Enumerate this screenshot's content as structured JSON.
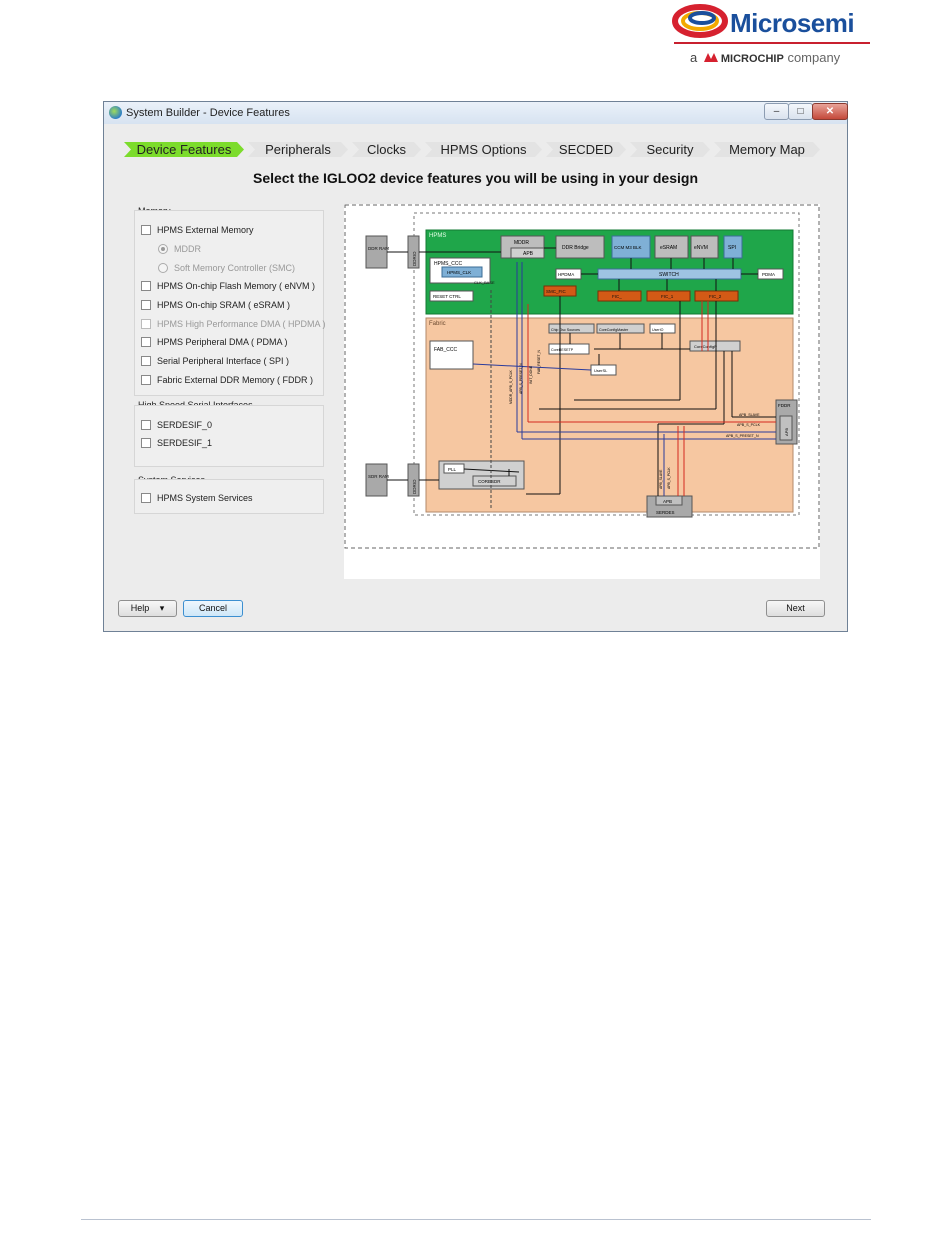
{
  "logo": {
    "wordmark": "Microsemi",
    "sub_a": "a",
    "sub_brand": "MICROCHIP",
    "sub_company": "company"
  },
  "window": {
    "title": "System Builder - Device Features",
    "controls": {
      "minimize": "–",
      "maximize": "□",
      "close": "✕"
    }
  },
  "steps": [
    "Device Features",
    "Peripherals",
    "Clocks",
    "HPMS Options",
    "SECDED",
    "Security",
    "Memory Map"
  ],
  "heading": "Select the IGLOO2 device features you will be using in your design",
  "memory": {
    "title": "Memory",
    "items": [
      "HPMS External Memory",
      "MDDR",
      "Soft Memory Controller (SMC)",
      "HPMS On-chip Flash Memory ( eNVM )",
      "HPMS On-chip SRAM ( eSRAM )",
      "HPMS High Performance DMA ( HPDMA )",
      "HPMS Peripheral DMA ( PDMA )",
      "Serial Peripheral Interface ( SPI )",
      "Fabric External DDR Memory ( FDDR )"
    ]
  },
  "serdes": {
    "title": "High Speed Serial Interfaces",
    "items": [
      "SERDESIF_0",
      "SERDESIF_1"
    ]
  },
  "services": {
    "title": "System Services",
    "items": [
      "HPMS System Services"
    ]
  },
  "diagram": {
    "hpms": "HPMS",
    "fabric": "Fabric",
    "ddr_ram_top": "DDR RAM",
    "ddr_ram_bottom": "SDR RAM",
    "mddr_io": "DDRIO",
    "fddr_io": "DDRIO",
    "mddr": "MDDR",
    "apb": "APB",
    "ddr_bridge": "DDR Bridge",
    "cortex": "CCM M3 BLK",
    "esram": "eSRAM",
    "envm": "eNVM",
    "spi": "SPI",
    "hpms_ccc": "HPMS_CCC",
    "hpms_clk": "HPMS_CLK",
    "reset_ctrl": "RESET CTRL",
    "hpdma": "HPDMA",
    "switch": "SWITCH",
    "pdma": "PDMA",
    "smc_fic": "SMC_FIC",
    "fic0": "FIC_",
    "fic1": "FIC_1",
    "fic2": "FIC_2",
    "clk_base": "CLK_BASE",
    "fab_ccc": "FAB_CCC",
    "chip_osc_src": "Chip Osc Sources",
    "core_config_master": "CoreConfigMaster",
    "user_io": "UserIO",
    "core_rst": "CoreRESETP",
    "core_config_p": "CoreConfigP",
    "user_sl": "UserSL",
    "pll": "PLL",
    "corexsdr": "CORESDR",
    "fddr": "FDDR",
    "fddr_apb": "APB",
    "apb_slave": "APB_SLAVE",
    "apb_s_clk": "APB_S_PCLK",
    "apb_s_preset": "APB_S_PRESET_N",
    "serdes_apb": "APB",
    "serdes": "SERDES",
    "sig_init_done": "INIT_DONE",
    "sig_fab_reset": "FAB_RESET_N",
    "sig_mddr_apb": "MDDR_APB_S_PCLK",
    "sig_apb_s_pclk": "APB_S_PCLK",
    "sig_apb_s_preset": "APB_S_PRESET_N",
    "sig_apb_slave": "APB_SLAVE"
  },
  "buttons": {
    "help": "Help",
    "help_arrow": "▾",
    "cancel": "Cancel",
    "next": "Next"
  }
}
